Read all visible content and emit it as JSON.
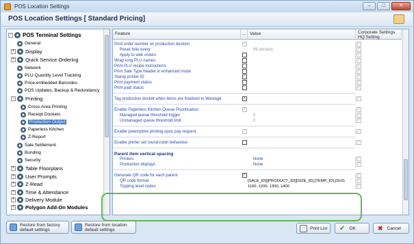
{
  "window": {
    "title": "POS Location Settings",
    "btn_min": "–",
    "btn_max": "□",
    "btn_close": "✕"
  },
  "header": {
    "title": "POS Location Settings  [ Standard Pricing]"
  },
  "tree": [
    {
      "label": "POS Terminal Settings",
      "level": 0,
      "exp": "−",
      "bold": true
    },
    {
      "label": "General",
      "level": 1
    },
    {
      "label": "Display",
      "level": 1,
      "exp": "+",
      "big": true
    },
    {
      "label": "Quick Service Ordering",
      "level": 1,
      "exp": "+",
      "big": true
    },
    {
      "label": "Network",
      "level": 1
    },
    {
      "label": "PLU Quantity Level Tracking",
      "level": 1
    },
    {
      "label": "Price-embedded Barcodes",
      "level": 1
    },
    {
      "label": "POS Updates, Backup & Redundancy",
      "level": 1
    },
    {
      "label": "Printing",
      "level": 1,
      "exp": "−",
      "big": true
    },
    {
      "label": "Cross-Area Printing",
      "level": 2
    },
    {
      "label": "Receipt Dockets",
      "level": 2
    },
    {
      "label": "Production Output",
      "level": 2,
      "selected": true
    },
    {
      "label": "Paperless Kitchen",
      "level": 2
    },
    {
      "label": "Z-Report",
      "level": 2
    },
    {
      "label": "Sale Settlement",
      "level": 1
    },
    {
      "label": "Bunding",
      "level": 1
    },
    {
      "label": "Security",
      "level": 1
    },
    {
      "label": "Table Floorplans",
      "level": 1,
      "exp": "+",
      "big": true
    },
    {
      "label": "User Prompts",
      "level": 1,
      "exp": "+",
      "big": true
    },
    {
      "label": "Z-Read",
      "level": 1,
      "exp": "+",
      "big": true
    },
    {
      "label": "Time & Attendance",
      "level": 1,
      "exp": "+",
      "big": true
    },
    {
      "label": "Delivery Module",
      "level": 1,
      "exp": "+",
      "big": true
    },
    {
      "label": "Polygon Add-On Modules",
      "level": 1,
      "exp": "+",
      "big": true,
      "bold": true
    }
  ],
  "grid": {
    "col_feature": "Feature",
    "col_dots": "...",
    "col_value": "Value",
    "col_corp_line1": "Corporate Settings",
    "col_corp_line2": "HQ Setting",
    "rows": [
      {
        "feature": "Print order number on production dockets",
        "indent": 0,
        "cb": "dis",
        "hq": "✓"
      },
      {
        "feature": "Reset folio every",
        "indent": 1,
        "cb": "none",
        "value": "99 dockets",
        "value_dim": true,
        "hq": "✓"
      },
      {
        "feature": "Apply to web orders",
        "indent": 1,
        "cb": "on",
        "hq": "✓"
      },
      {
        "feature": "Wrap long PLU names",
        "indent": 0,
        "cb": "on",
        "hq": "✓"
      },
      {
        "feature": "Print PLU recipe instructions",
        "indent": 0,
        "cb": "on",
        "hq": "✓"
      },
      {
        "feature": "Print Sale Type header in enhanced mode",
        "indent": 0,
        "cb": "on",
        "hq": "✓"
      },
      {
        "feature": "Stamp printer ID",
        "indent": 0,
        "cb": "on",
        "hq": "✓"
      },
      {
        "feature": "Print payment status",
        "indent": 0,
        "cb": "on",
        "hq": "✓"
      },
      {
        "feature": "Print paid status",
        "indent": 0,
        "cb": "on",
        "hq": "✓"
      },
      {
        "divider": true
      },
      {
        "feature": "Tag production docket when items are finalised to Wastage",
        "indent": 0,
        "cb": "on",
        "checked": true,
        "hq": "✓"
      },
      {
        "divider": true
      },
      {
        "feature": "Enable Paperless Kitchen Queue Prioritisation",
        "indent": 0,
        "cb": "dis",
        "hq": "✓"
      },
      {
        "feature": "Managed queue threshold trigger",
        "indent": 1,
        "cb": "none",
        "value": "0",
        "value_dim": true,
        "hq": "✓"
      },
      {
        "feature": "Unmanaged queue threshold limit",
        "indent": 1,
        "cb": "none",
        "value": "0",
        "value_dim": true,
        "hq": "✓"
      },
      {
        "divider": true
      },
      {
        "feature": "Enable preemptive printing upon pay request",
        "indent": 0,
        "cb": "dis",
        "hq": "✓"
      },
      {
        "divider": true
      },
      {
        "feature": "Enable printer set round-robin behaviour",
        "indent": 0,
        "cb": "on",
        "hq": "✓"
      },
      {
        "divider": true
      },
      {
        "feature": "Parent item vertical spacing",
        "indent": 0,
        "header": true
      },
      {
        "feature": "Printers",
        "indent": 1,
        "cb": "none",
        "value": "None",
        "hq": "✓"
      },
      {
        "feature": "Production displays",
        "indent": 1,
        "cb": "none",
        "value": "None",
        "hq": "✓"
      },
      {
        "divider": true
      },
      {
        "feature": "Generate QR code for each parent",
        "indent": 0,
        "cb": "on",
        "checked": true,
        "hq": "✓"
      },
      {
        "feature": "QR code format",
        "indent": 1,
        "cb": "none",
        "valtext": "[SALE_ID]|[PRODUCT_ID]|[SIZE_ID],[TEMP_ID],[SUG",
        "hq": "✓"
      },
      {
        "feature": "Topping level codes",
        "indent": 1,
        "cb": "none",
        "valtext": "1100, 1200, 1300, 1400",
        "hq": "✓"
      }
    ]
  },
  "buttons": {
    "restore_factory_l1": "Restore from factory",
    "restore_factory_l2": "default settings",
    "restore_location_l1": "Restore from location",
    "restore_location_l2": "default settings",
    "print_list": "Print List",
    "ok": "OK",
    "cancel": "Cancel"
  }
}
